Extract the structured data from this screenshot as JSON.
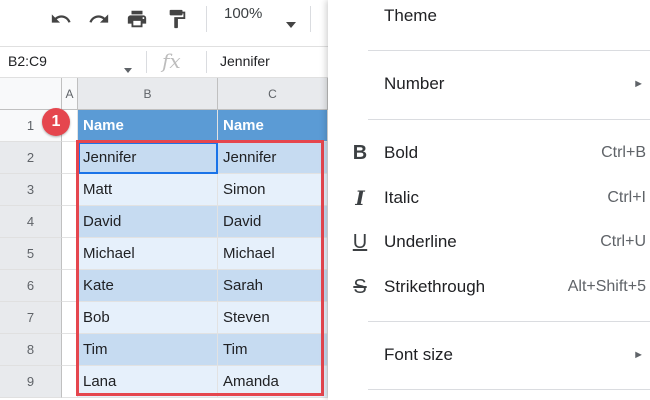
{
  "toolbar": {
    "zoom": "100%"
  },
  "formula_bar": {
    "name_box": "B2:C9",
    "fx_symbol": "fx",
    "value": "Jennifer"
  },
  "grid": {
    "columns": [
      "A",
      "B",
      "C"
    ],
    "rows": [
      "1",
      "2",
      "3",
      "4",
      "5",
      "6",
      "7",
      "8",
      "9"
    ],
    "header": [
      "Name",
      "Name"
    ],
    "data": [
      [
        "Jennifer",
        "Jennifer"
      ],
      [
        "Matt",
        "Simon"
      ],
      [
        "David",
        "David"
      ],
      [
        "Michael",
        "Michael"
      ],
      [
        "Kate",
        "Sarah"
      ],
      [
        "Bob",
        "Steven"
      ],
      [
        "Tim",
        "Tim"
      ],
      [
        "Lana",
        "Amanda"
      ]
    ],
    "badge": "1",
    "colors": {
      "header": "#5b9bd5",
      "band_dark": "#c6dbf1",
      "band_light": "#e6f0fb",
      "selection_outline": "#e5464e",
      "active_cell": "#1a73e8"
    }
  },
  "menu": {
    "theme": "Theme",
    "number": "Number",
    "bold": {
      "icon": "B",
      "label": "Bold",
      "shortcut": "Ctrl+B"
    },
    "italic": {
      "icon": "I",
      "label": "Italic",
      "shortcut": "Ctrl+I"
    },
    "underline": {
      "icon": "U",
      "label": "Underline",
      "shortcut": "Ctrl+U"
    },
    "strikethrough": {
      "icon": "S",
      "label": "Strikethrough",
      "shortcut": "Alt+Shift+5"
    },
    "font_size": "Font size",
    "submenu_arrow": "►"
  }
}
